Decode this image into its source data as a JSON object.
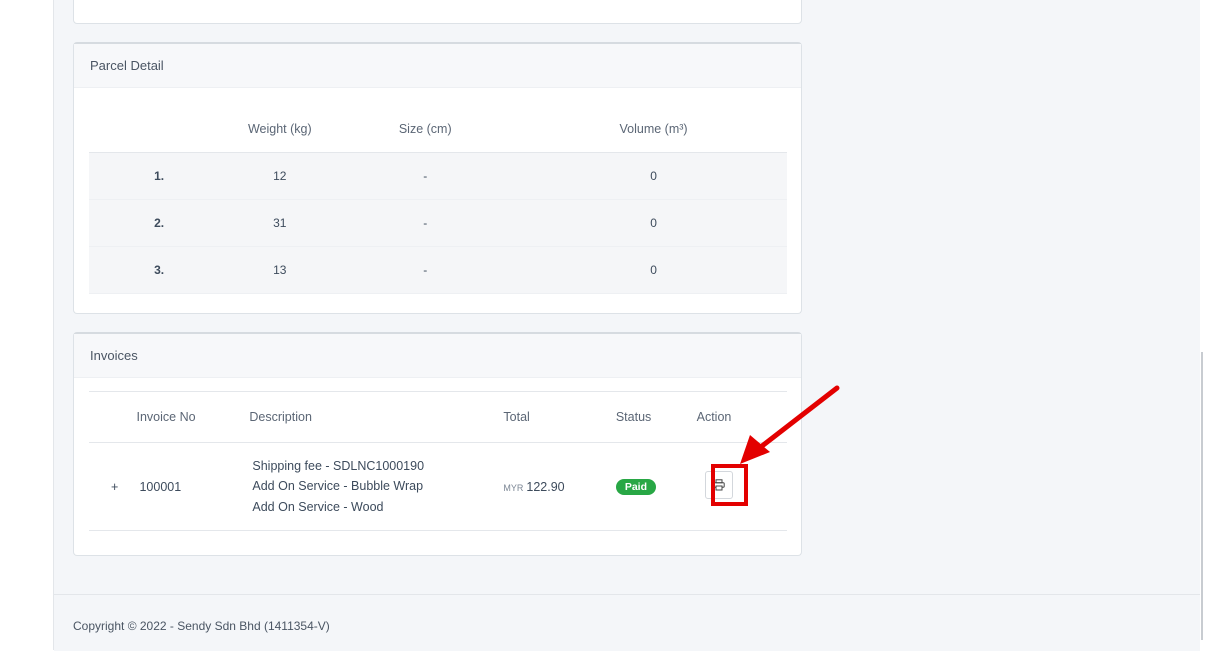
{
  "parcel_detail": {
    "title": "Parcel Detail",
    "columns": [
      "",
      "Weight (kg)",
      "Size (cm)",
      "Volume (m³)"
    ],
    "rows": [
      {
        "index": "1.",
        "weight": "12",
        "size": "-",
        "volume": "0"
      },
      {
        "index": "2.",
        "weight": "31",
        "size": "-",
        "volume": "0"
      },
      {
        "index": "3.",
        "weight": "13",
        "size": "-",
        "volume": "0"
      }
    ]
  },
  "invoices": {
    "title": "Invoices",
    "columns": {
      "invoice_no": "Invoice No",
      "description": "Description",
      "total": "Total",
      "status": "Status",
      "action": "Action"
    },
    "rows": [
      {
        "expand": "+",
        "invoice_no": "100001",
        "description": [
          "Shipping fee - SDLNC1000190",
          "Add On Service - Bubble Wrap",
          "Add On Service - Wood"
        ],
        "currency": "MYR",
        "amount": "122.90",
        "status": "Paid",
        "status_color": "#28a745",
        "action_icon": "printer-icon"
      }
    ]
  },
  "footer": {
    "copyright": "Copyright © 2022 - Sendy Sdn Bhd (1411354-V)"
  },
  "annotation": {
    "highlight_color": "#e30000"
  }
}
